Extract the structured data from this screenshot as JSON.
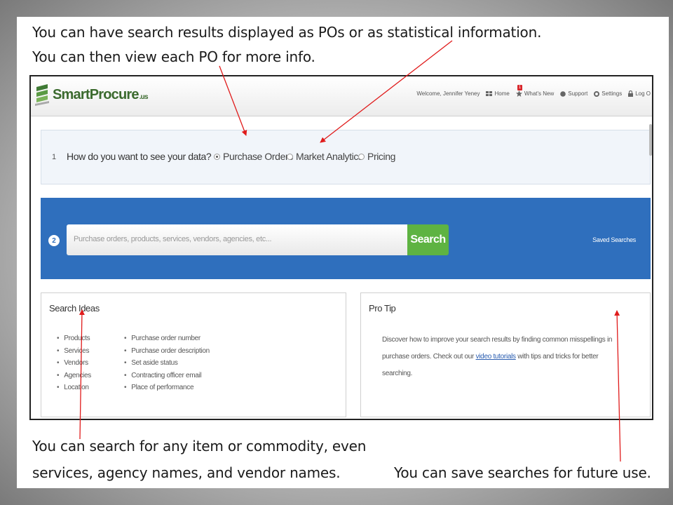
{
  "slide": {
    "captions": {
      "top1": "You can have search results displayed as POs or as statistical information.",
      "top2": "You can then view each PO for more info.",
      "bottom1": "You can search for any item or commodity, even",
      "bottom2": "services, agency names, and vendor names.",
      "bottom3": "You can save searches for future use."
    },
    "arrow_color": "#e01b1b"
  },
  "app": {
    "logo": {
      "text": "SmartProcure",
      "suffix": ".us",
      "color": "#3b6a2e"
    },
    "nav": {
      "welcome": "Welcome, Jennifer Yeney",
      "home": "Home",
      "whats_new": "What's New",
      "whats_new_badge": "1",
      "support": "Support",
      "settings": "Settings",
      "logout": "Log O"
    },
    "step1": {
      "number": "1",
      "question": "How do you want to see your data?",
      "options": [
        {
          "label": "Purchase Orders",
          "selected": true
        },
        {
          "label": "Market Analytics",
          "selected": false
        },
        {
          "label": "Pricing",
          "selected": false
        }
      ]
    },
    "step2": {
      "number": "2",
      "placeholder": "Purchase orders, products, services, vendors, agencies, etc...",
      "search_label": "Search",
      "saved_searches": "Saved Searches",
      "band_color": "#2f6fbd",
      "button_color": "#5eb342"
    },
    "search_ideas": {
      "title": "Search Ideas",
      "col1": [
        "Products",
        "Services",
        "Vendors",
        "Agencies",
        "Location"
      ],
      "col2": [
        "Purchase order number",
        "Purchase order description",
        "Set aside status",
        "Contracting officer email",
        "Place of performance"
      ]
    },
    "pro_tip": {
      "title": "Pro Tip",
      "text_before": "Discover how to improve your search results by finding common misspellings in purchase orders. Check out our",
      "link": "video tutorials",
      "text_after": "with tips and tricks for better searching."
    }
  }
}
